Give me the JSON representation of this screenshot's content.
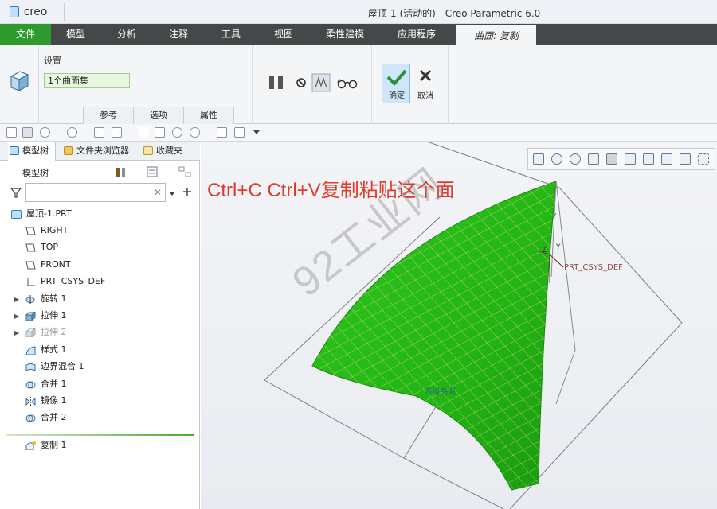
{
  "app": {
    "logo_text": "creo",
    "window_title": "屋顶-1 (活动的) - Creo Parametric 6.0"
  },
  "ribbon": {
    "tabs": [
      {
        "label": "文件"
      },
      {
        "label": "模型"
      },
      {
        "label": "分析"
      },
      {
        "label": "注释"
      },
      {
        "label": "工具"
      },
      {
        "label": "视图"
      },
      {
        "label": "柔性建模"
      },
      {
        "label": "应用程序"
      }
    ],
    "active_tab": "曲面: 复制",
    "settings_label": "设置",
    "surface_set_value": "1个曲面集",
    "subtabs": [
      "参考",
      "选项",
      "属性"
    ],
    "confirm_label": "确定",
    "cancel_label": "取消"
  },
  "panel": {
    "tabs": [
      "模型树",
      "文件夹浏览器",
      "收藏夹"
    ],
    "tree_title": "模型树",
    "filter_placeholder": "",
    "root": "屋顶-1.PRT",
    "items": [
      {
        "label": "RIGHT"
      },
      {
        "label": "TOP"
      },
      {
        "label": "FRONT"
      },
      {
        "label": "PRT_CSYS_DEF"
      },
      {
        "label": "旋转 1"
      },
      {
        "label": "拉伸 1"
      },
      {
        "label": "拉伸 2"
      },
      {
        "label": "样式 1"
      },
      {
        "label": "边界混合 1"
      },
      {
        "label": "合并 1"
      },
      {
        "label": "镜像 1"
      },
      {
        "label": "合并 2"
      }
    ],
    "new_feature": "复制 1"
  },
  "viewport": {
    "annotation": "Ctrl+C Ctrl+V复制粘贴这个面",
    "watermark": "92工业网",
    "csys_label": "PRT_CSYS_DEF",
    "axis_z": "Z",
    "axis_y": "Y",
    "surface_label": "面组曲面"
  },
  "colors": {
    "file_tab": "#2e9b2f",
    "surface_green": "#22b514",
    "annotation_red": "#e03a2a"
  }
}
